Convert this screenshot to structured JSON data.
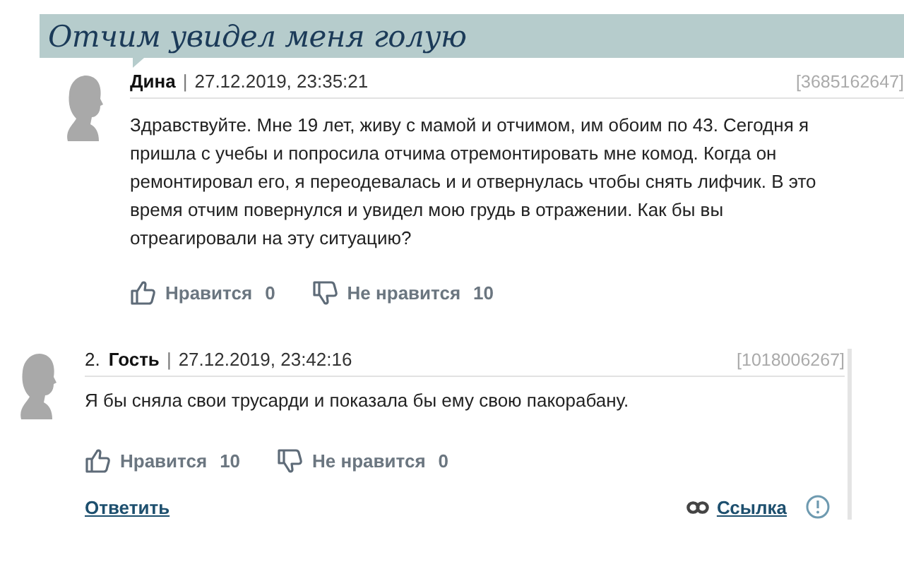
{
  "title": "Отчим увидел меня голую",
  "posts": [
    {
      "author": "Дина",
      "separator": "|",
      "date": "27.12.2019, 23:35:21",
      "id": "[3685162647]",
      "body": "Здравствуйте. Мне 19 лет, живу с мамой и отчимом, им обоим по 43. Сегодня я пришла с учебы и попросила отчима отремонтировать мне комод. Когда он ремонтировал его, я переодевалась и и отвернулась чтобы снять лифчик. В это время отчим повернулся и увидел мою грудь в отражении. Как бы вы отреагировали на эту ситуацию?",
      "reactions": [
        {
          "kind": "like",
          "label": "Нравится",
          "count": "0"
        },
        {
          "kind": "dislike",
          "label": "Не нравится",
          "count": "10"
        }
      ]
    },
    {
      "number": "2.",
      "author": "Гость",
      "separator": "|",
      "date": "27.12.2019, 23:42:16",
      "id": "[1018006267]",
      "body": "Я бы сняла свои трусарди и показала бы ему свою пакорабану.",
      "reactions": [
        {
          "kind": "like",
          "label": "Нравится",
          "count": "10"
        },
        {
          "kind": "dislike",
          "label": "Не нравится",
          "count": "0"
        }
      ],
      "reply": "Ответить",
      "link": "Ссылка"
    }
  ]
}
